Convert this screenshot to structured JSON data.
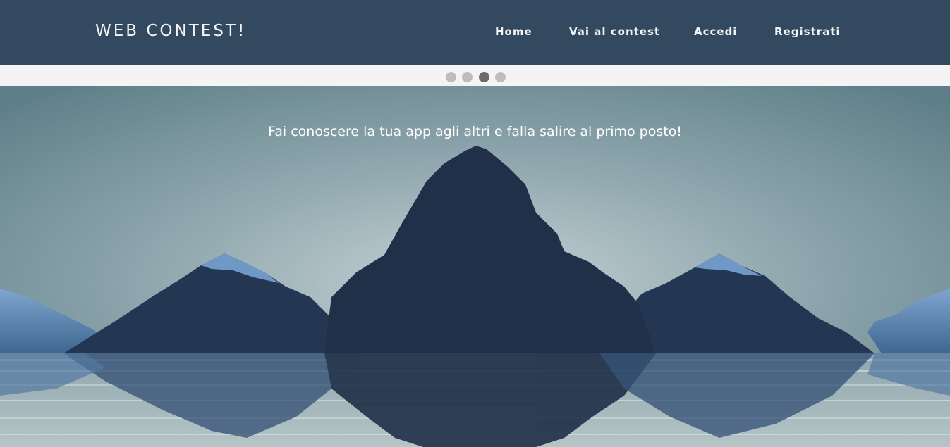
{
  "header": {
    "brand": "WEB CONTEST!",
    "nav": {
      "home": "Home",
      "contest": "Vai al contest",
      "login": "Accedi",
      "register": "Registrati"
    }
  },
  "carousel": {
    "slide_count": 4,
    "active_index": 2,
    "caption": "Fai conoscere la tua app agli altri e falla salire al primo posto!"
  },
  "colors": {
    "navbar": "#33495f",
    "nav_text": "#f2f4f6",
    "dot_inactive": "#bdbdbd",
    "dot_active": "#6b6b6b",
    "mountain": "#1f3048",
    "snow": "#5e88b5"
  }
}
